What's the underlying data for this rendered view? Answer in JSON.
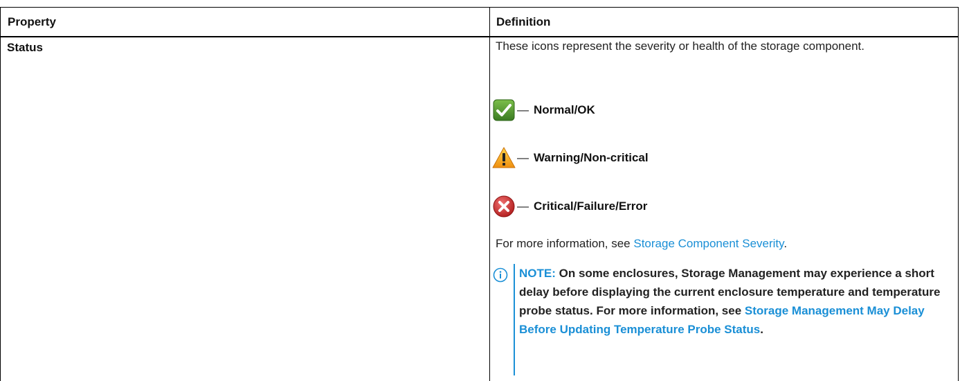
{
  "table": {
    "headers": {
      "property": "Property",
      "definition": "Definition"
    },
    "row": {
      "property": "Status",
      "intro": "These icons represent the severity or health of the storage component.",
      "severities": [
        {
          "icon": "check-icon",
          "dash": "—",
          "label": "Normal/OK",
          "color": "#4f8f2f"
        },
        {
          "icon": "warning-icon",
          "dash": "—",
          "label": "Warning/Non-critical",
          "color": "#f0a020"
        },
        {
          "icon": "error-icon",
          "dash": "—",
          "label": "Critical/Failure/Error",
          "color": "#c62b2b"
        }
      ],
      "more_info_prefix": "For more information, see ",
      "more_info_link": "Storage Component Severity",
      "more_info_suffix": ".",
      "note": {
        "icon": "info-icon",
        "label": "NOTE:",
        "text": " On some enclosures, Storage Management may experience a short delay before displaying the current enclosure temperature and temperature probe status. For more information, see ",
        "link": "Storage Management May Delay Before Updating Temperature Probe Status",
        "suffix": "."
      }
    }
  },
  "colors": {
    "link": "#1a8fd6",
    "border": "#000000",
    "text": "#222222"
  }
}
